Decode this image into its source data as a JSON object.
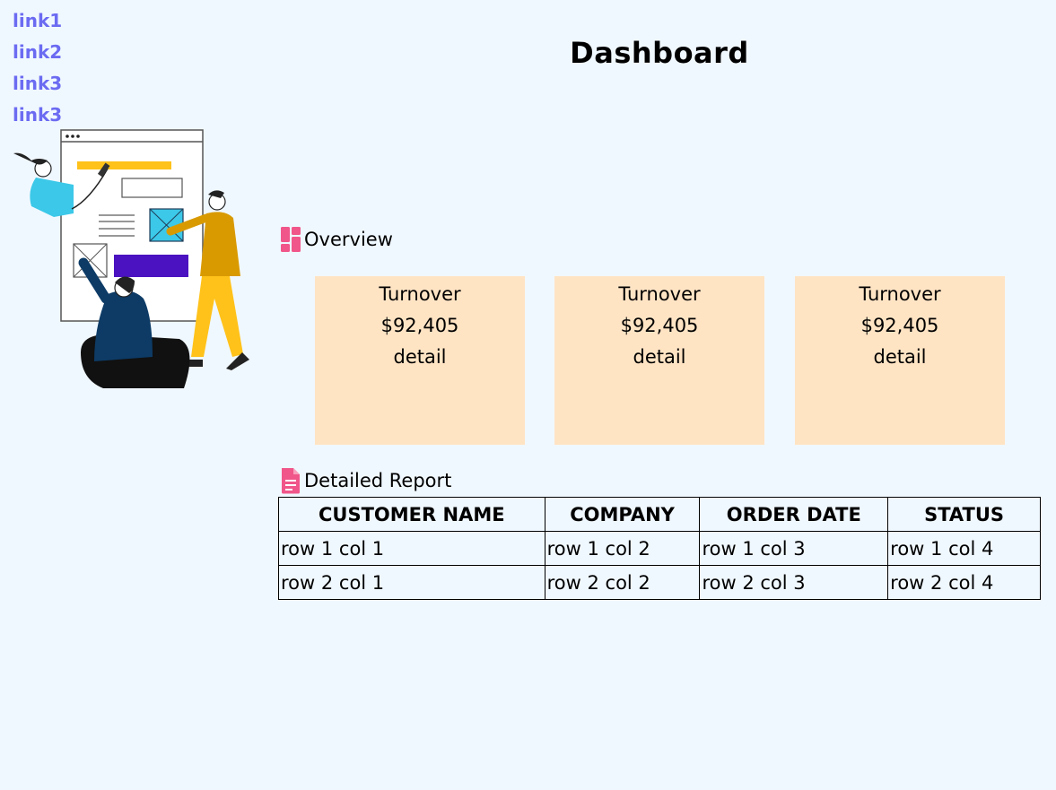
{
  "nav": {
    "links": [
      "link1",
      "link2",
      "link3",
      "link3"
    ]
  },
  "header": {
    "title": "Dashboard"
  },
  "overview": {
    "heading": "Overview",
    "icon": "dashboard-icon",
    "cards": [
      {
        "title": "Turnover",
        "value": "$92,405",
        "link": "detail"
      },
      {
        "title": "Turnover",
        "value": "$92,405",
        "link": "detail"
      },
      {
        "title": "Turnover",
        "value": "$92,405",
        "link": "detail"
      }
    ]
  },
  "report": {
    "heading": "Detailed Report",
    "icon": "document-icon",
    "columns": [
      "CUSTOMER NAME",
      "COMPANY",
      "ORDER DATE",
      "STATUS"
    ],
    "rows": [
      [
        "row 1 col 1",
        "row 1 col 2",
        "row 1 col 3",
        "row 1 col 4"
      ],
      [
        "row 2 col 1",
        "row 2 col 2",
        "row 2 col 3",
        "row 2 col 4"
      ]
    ]
  },
  "colors": {
    "background": "#f0f8ff",
    "link": "#6b6bf2",
    "card": "#ffe4c4",
    "icon_accent": "#f0568a"
  }
}
